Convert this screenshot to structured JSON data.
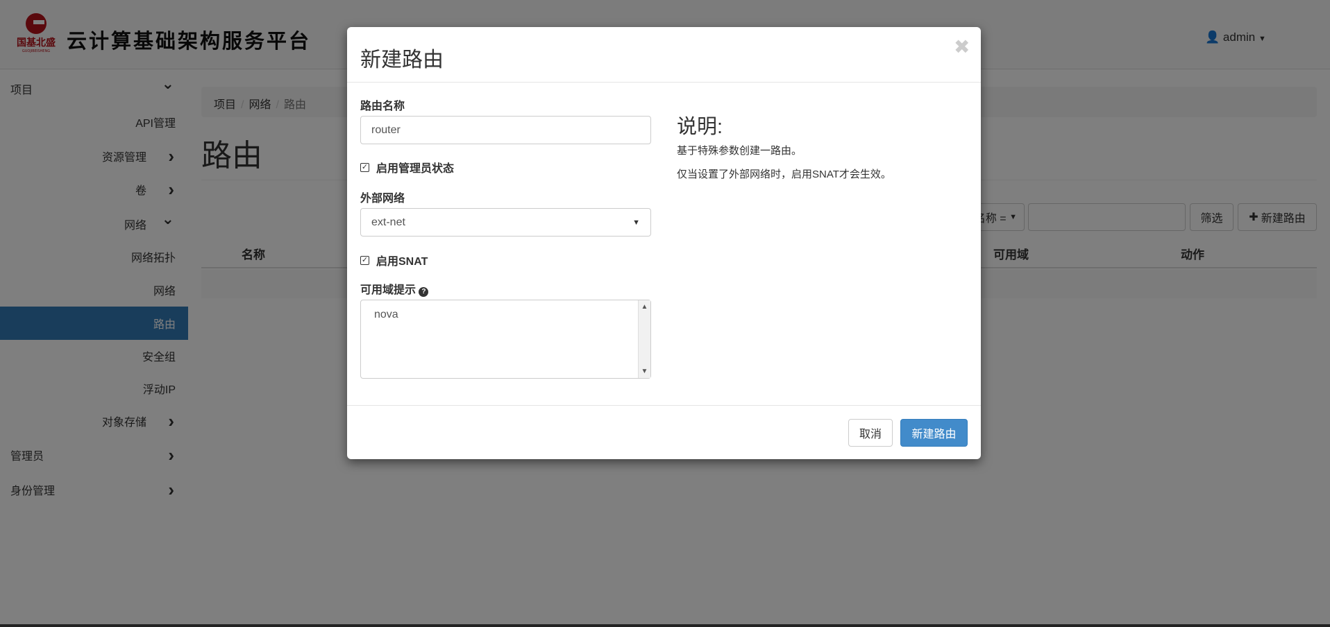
{
  "header": {
    "logo_text": "国基北盛",
    "logo_sub": "GUOJIBEISHENG",
    "brand": "云计算基础架构服务平台",
    "user": "admin"
  },
  "sidebar": {
    "items": [
      {
        "label": "项目",
        "level": "top",
        "chevron": "down"
      },
      {
        "label": "API管理",
        "level": "sub"
      },
      {
        "label": "资源管理",
        "level": "mid",
        "chevron": "right"
      },
      {
        "label": "卷",
        "level": "mid",
        "chevron": "right"
      },
      {
        "label": "网络",
        "level": "mid",
        "chevron": "down"
      },
      {
        "label": "网络拓扑",
        "level": "sub"
      },
      {
        "label": "网络",
        "level": "sub"
      },
      {
        "label": "路由",
        "level": "sub",
        "active": true
      },
      {
        "label": "安全组",
        "level": "sub"
      },
      {
        "label": "浮动IP",
        "level": "sub"
      },
      {
        "label": "对象存储",
        "level": "mid",
        "chevron": "right"
      },
      {
        "label": "管理员",
        "level": "top",
        "chevron": "right"
      },
      {
        "label": "身份管理",
        "level": "top",
        "chevron": "right"
      }
    ]
  },
  "breadcrumb": [
    "项目",
    "网络",
    "路由"
  ],
  "page": {
    "title": "路由",
    "filter_field": "名称 =",
    "filter_value": "",
    "filter_button": "筛选",
    "create_button": "新建路由",
    "columns": [
      "名称",
      "可用域",
      "动作"
    ]
  },
  "modal": {
    "title": "新建路由",
    "name_label": "路由名称",
    "name_value": "router",
    "admin_state_label": "启用管理员状态",
    "admin_state_checked": true,
    "ext_net_label": "外部网络",
    "ext_net_value": "ext-net",
    "snat_label": "启用SNAT",
    "snat_checked": true,
    "az_label": "可用域提示",
    "az_options": [
      "nova"
    ],
    "help_title": "说明:",
    "help_lines": [
      "基于特殊参数创建一路由。",
      "仅当设置了外部网络时，启用SNAT才会生效。"
    ],
    "cancel": "取消",
    "submit": "新建路由"
  },
  "colors": {
    "primary": "#337ab7",
    "submit": "#428bca"
  }
}
